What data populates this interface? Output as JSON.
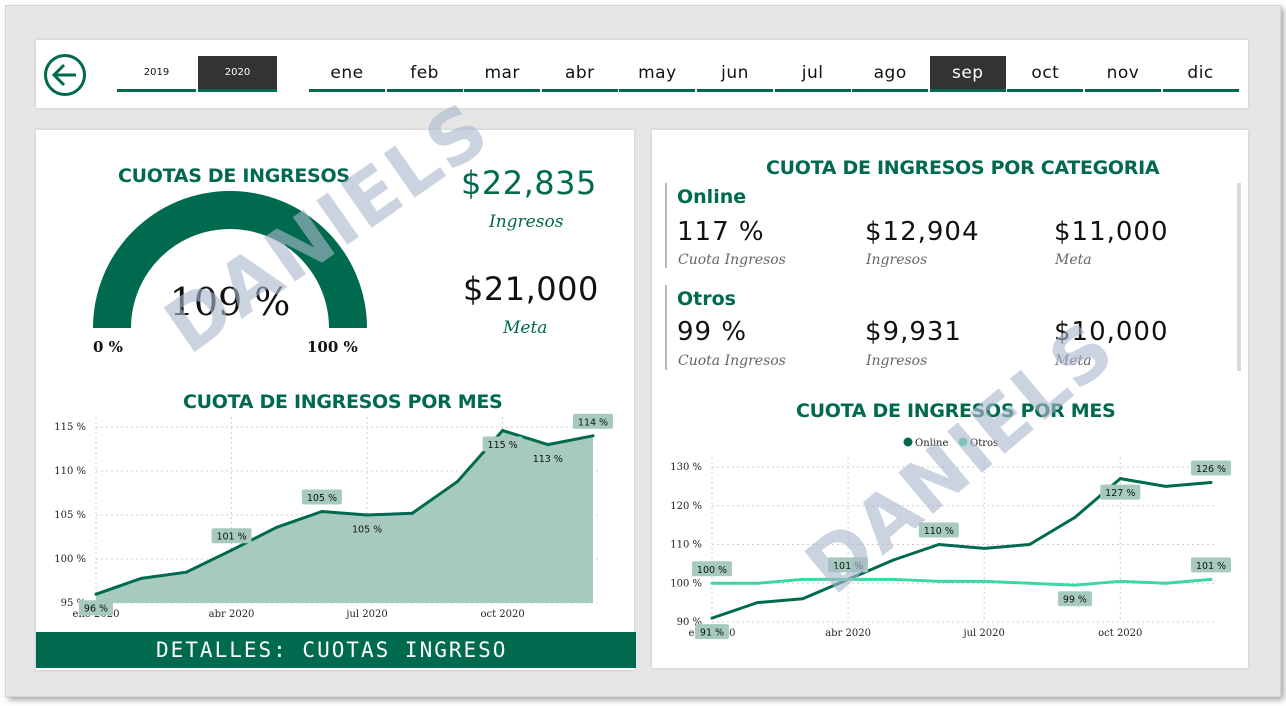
{
  "nav": {
    "years": [
      "2019",
      "2020"
    ],
    "selected_year": "2020",
    "months": [
      "ene",
      "feb",
      "mar",
      "abr",
      "may",
      "jun",
      "jul",
      "ago",
      "sep",
      "oct",
      "nov",
      "dic"
    ],
    "selected_month": "sep"
  },
  "left": {
    "gauge_title": "CUOTAS DE INGRESOS",
    "gauge_value": "109 %",
    "gauge_fraction": 1.0,
    "gauge_min": "0 %",
    "gauge_max": "100 %",
    "ingresos_value": "$22,835",
    "ingresos_label": "Ingresos",
    "meta_value": "$21,000",
    "meta_label": "Meta",
    "chart_title": "CUOTA DE INGRESOS POR MES",
    "details_button": "DETALLES: CUOTAS INGRESO"
  },
  "right": {
    "category_title": "CUOTA DE INGRESOS POR CATEGORIA",
    "categories": [
      {
        "name": "Online",
        "cuota": "117 %",
        "cuota_label": "Cuota Ingresos",
        "ingresos": "$12,904",
        "ingresos_label": "Ingresos",
        "meta": "$11,000",
        "meta_label": "Meta"
      },
      {
        "name": "Otros",
        "cuota": "99 %",
        "cuota_label": "Cuota Ingresos",
        "ingresos": "$9,931",
        "ingresos_label": "Ingresos",
        "meta": "$10,000",
        "meta_label": "Meta"
      }
    ],
    "chart_title": "CUOTA DE INGRESOS POR MES"
  },
  "watermark": "DANIELS",
  "colors": {
    "accent": "#006a4e",
    "area_fill": "#a6cbbe",
    "otros_line": "#3dd6a5",
    "selected_bg": "#333333",
    "label_bg": "#a6cbbe"
  },
  "chart_data": [
    {
      "type": "area",
      "title": "CUOTA DE INGRESOS POR MES",
      "x": [
        "ene 2020",
        "feb 2020",
        "mar 2020",
        "abr 2020",
        "may 2020",
        "jun 2020",
        "jul 2020",
        "ago 2020",
        "sep 2020",
        "oct 2020",
        "nov 2020",
        "dic 2020"
      ],
      "values": [
        96,
        97.8,
        98.5,
        101,
        103.6,
        105.4,
        105,
        105.2,
        108.8,
        114.6,
        113,
        114
      ],
      "ylim": [
        95,
        115
      ],
      "yticks": [
        "95 %",
        "100 %",
        "105 %",
        "110 %",
        "115 %"
      ],
      "xticks": [
        "ene 2020",
        "abr 2020",
        "jul 2020",
        "oct 2020"
      ],
      "data_labels": [
        {
          "index": 0,
          "text": "96 %",
          "pos": "below"
        },
        {
          "index": 3,
          "text": "101 %",
          "pos": "above"
        },
        {
          "index": 5,
          "text": "105 %",
          "pos": "above"
        },
        {
          "index": 6,
          "text": "105 %",
          "pos": "below"
        },
        {
          "index": 9,
          "text": "115 %",
          "pos": "below"
        },
        {
          "index": 10,
          "text": "113 %",
          "pos": "below"
        },
        {
          "index": 11,
          "text": "114 %",
          "pos": "above"
        }
      ],
      "grid": true
    },
    {
      "type": "line",
      "title": "CUOTA DE INGRESOS POR MES",
      "x": [
        "ene 2020",
        "feb 2020",
        "mar 2020",
        "abr 2020",
        "may 2020",
        "jun 2020",
        "jul 2020",
        "ago 2020",
        "sep 2020",
        "oct 2020",
        "nov 2020",
        "dic 2020"
      ],
      "series": [
        {
          "name": "Online",
          "values": [
            91,
            95,
            96,
            101,
            106,
            110,
            109,
            110,
            117,
            127,
            125,
            126
          ]
        },
        {
          "name": "Otros",
          "values": [
            100,
            100,
            101,
            101,
            101,
            100.5,
            100.5,
            100,
            99.5,
            100.5,
            100,
            101
          ]
        }
      ],
      "ylim": [
        90,
        130
      ],
      "yticks": [
        "90 %",
        "100 %",
        "110 %",
        "120 %",
        "130 %"
      ],
      "xticks": [
        "ene 2020",
        "abr 2020",
        "jul 2020",
        "oct 2020"
      ],
      "data_labels": [
        {
          "series": 0,
          "index": 0,
          "text": "91 %",
          "pos": "below"
        },
        {
          "series": 0,
          "index": 3,
          "text": "101 %",
          "pos": "above"
        },
        {
          "series": 0,
          "index": 5,
          "text": "110 %",
          "pos": "above"
        },
        {
          "series": 0,
          "index": 9,
          "text": "127 %",
          "pos": "below"
        },
        {
          "series": 0,
          "index": 11,
          "text": "126 %",
          "pos": "above"
        },
        {
          "series": 1,
          "index": 0,
          "text": "100 %",
          "pos": "above"
        },
        {
          "series": 1,
          "index": 8,
          "text": "99 %",
          "pos": "below"
        },
        {
          "series": 1,
          "index": 11,
          "text": "101 %",
          "pos": "above"
        }
      ],
      "legend": "top-center",
      "grid": true
    }
  ]
}
